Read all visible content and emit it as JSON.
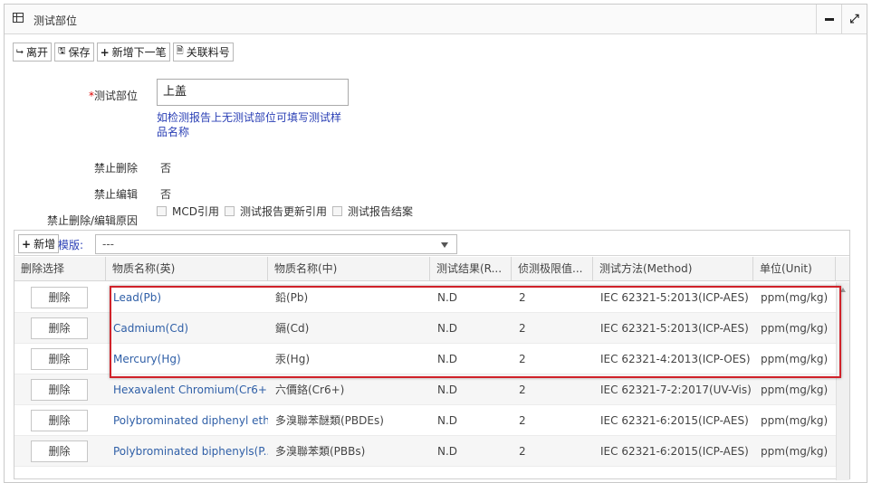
{
  "window": {
    "title": "测试部位"
  },
  "toolbar": {
    "leave": "离开",
    "save": "保存",
    "add_next": "新增下一笔",
    "link_material": "关联料号"
  },
  "form": {
    "part_label": "测试部位",
    "required_mark": "*",
    "part_value": "上盖",
    "part_hint": "如检测报告上无测试部位可填写测试样品名称",
    "no_delete_label": "禁止删除",
    "no_delete_value": "否",
    "no_edit_label": "禁止编辑",
    "no_edit_value": "否",
    "reason_label": "禁止删除/编辑原因",
    "reasons": [
      "MCD引用",
      "测试报告更新引用",
      "测试报告结案"
    ]
  },
  "grid": {
    "add_label": "新增",
    "template_label": "模版:",
    "template_value": "---",
    "headers": [
      "删除选择",
      "物质名称(英)",
      "物质名称(中)",
      "测试结果(R...",
      "侦测极限值...",
      "测试方法(Method)",
      "单位(Unit)"
    ],
    "delete_label": "删除",
    "rows": [
      {
        "en": "Lead(Pb)",
        "cn": "鉛(Pb)",
        "result": "N.D",
        "limit": "2",
        "method": "IEC 62321-5:2013(ICP-AES)",
        "unit": "ppm(mg/kg)"
      },
      {
        "en": "Cadmium(Cd)",
        "cn": "鎘(Cd)",
        "result": "N.D",
        "limit": "2",
        "method": "IEC 62321-5:2013(ICP-AES)",
        "unit": "ppm(mg/kg)"
      },
      {
        "en": "Mercury(Hg)",
        "cn": "汞(Hg)",
        "result": "N.D",
        "limit": "2",
        "method": "IEC 62321-4:2013(ICP-OES)",
        "unit": "ppm(mg/kg)"
      },
      {
        "en": "Hexavalent Chromium(Cr6+)",
        "cn": "六價鉻(Cr6+)",
        "result": "N.D",
        "limit": "2",
        "method": "IEC 62321-7-2:2017(UV-Vis)",
        "unit": "ppm(mg/kg)"
      },
      {
        "en": "Polybrominated diphenyl eth...",
        "cn": "多溴聯苯醚類(PBDEs)",
        "result": "N.D",
        "limit": "2",
        "method": "IEC 62321-6:2015(ICP-AES)",
        "unit": "ppm(mg/kg)"
      },
      {
        "en": "Polybrominated biphenyls(P...",
        "cn": "多溴聯苯類(PBBs)",
        "result": "N.D",
        "limit": "2",
        "method": "IEC 62321-6:2015(ICP-AES)",
        "unit": "ppm(mg/kg)"
      }
    ]
  },
  "colors": {
    "highlight": "#d0222a",
    "link": "#2f5fa7",
    "hint": "#2a3fb5"
  }
}
